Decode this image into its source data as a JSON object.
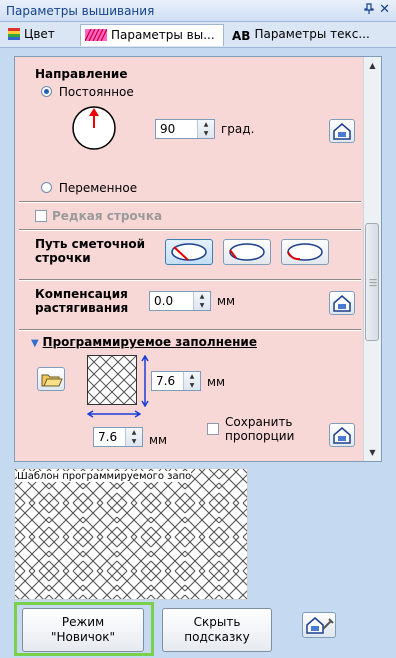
{
  "window": {
    "title": "Параметры вышивания",
    "pin_glyph": "ꟷ",
    "close_glyph": "✕"
  },
  "tabs": [
    {
      "label": "Цвет",
      "icon": "color-palette-icon"
    },
    {
      "label": "Параметры вы...",
      "icon": "sewing-pattern-icon"
    },
    {
      "label": "Параметры текс...",
      "icon": "ab-text-icon",
      "icon_text": "AB"
    }
  ],
  "direction": {
    "heading": "Направление",
    "constant_label": "Постоянное",
    "angle_value": "90",
    "angle_unit": "град.",
    "variable_label": "Переменное",
    "selected": "constant"
  },
  "sparse_stitch": {
    "label": "Редкая строчка",
    "enabled": false
  },
  "basting_path": {
    "label_line1": "Путь сметочной",
    "label_line2": "строчки",
    "selected_index": 0
  },
  "pull_compensation": {
    "label_line1": "Компенсация",
    "label_line2": "растягивания",
    "value": "0.0",
    "unit": "мм"
  },
  "programmable_fill": {
    "heading": "Программируемое заполнение",
    "collapse_glyph": "▼",
    "height_value": "7.6",
    "width_value": "7.6",
    "unit": "мм",
    "keep_proportions_line1": "Сохранить",
    "keep_proportions_line2": "пропорции"
  },
  "preview": {
    "caption": "Шаблон программируемого запо"
  },
  "buttons": {
    "novice_line1": "Режим",
    "novice_line2": "\"Новичок\"",
    "hide_hint_line1": "Скрыть",
    "hide_hint_line2": "подсказку"
  },
  "colors": {
    "panel_bg": "#f8d8d6",
    "frame_bg": "#c5d9f1",
    "accent_blue": "#1a3fd8",
    "highlight_green": "#7ad04a"
  }
}
